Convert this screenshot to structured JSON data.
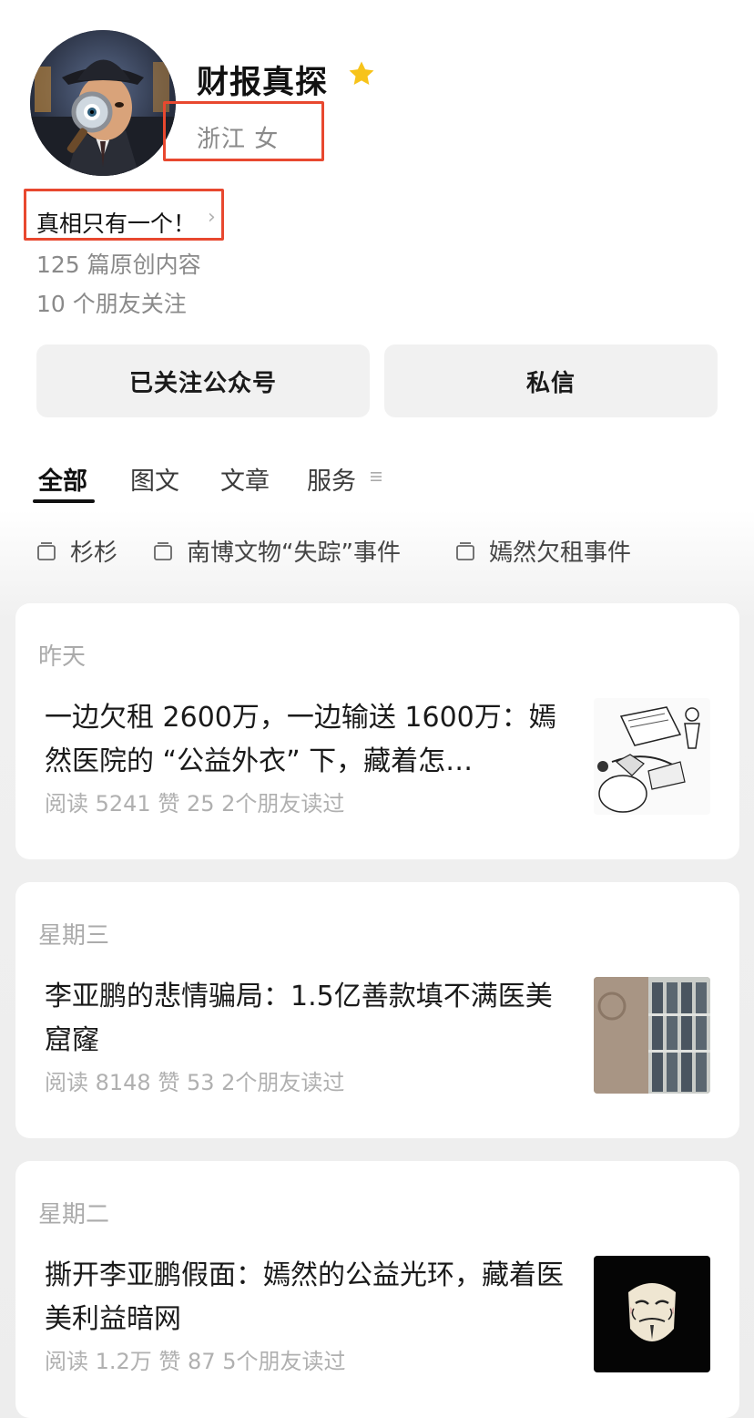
{
  "profile": {
    "name": "财报真探",
    "region": "浙江 女",
    "slogan": "真相只有一个！",
    "original_count": "125 篇原创内容",
    "friends_following": "10 个朋友关注",
    "star_icon": "star-icon",
    "accent_color": "#e8482f",
    "star_color": "#f7c31a"
  },
  "buttons": {
    "follow_label": "已关注公众号",
    "message_label": "私信"
  },
  "tabs": [
    {
      "label": "全部",
      "active": true
    },
    {
      "label": "图文",
      "active": false
    },
    {
      "label": "文章",
      "active": false
    },
    {
      "label": "服务",
      "active": false
    }
  ],
  "collections": [
    {
      "label": "杉杉"
    },
    {
      "label": "南博文物“失踪”事件"
    },
    {
      "label": "嫣然欠租事件"
    }
  ],
  "articles": [
    {
      "date": "昨天",
      "title": "一边欠租 2600万，一边输送 1600万：嫣然医院的 “公益外衣” 下，藏着怎…",
      "meta": "阅读 5241  赞 25  2个朋友读过"
    },
    {
      "date": "星期三",
      "title": "李亚鹏的悲情骗局：1.5亿善款填不满医美窟窿",
      "meta": "阅读 8148  赞 53  2个朋友读过"
    },
    {
      "date": "星期二",
      "title": "撕开李亚鹏假面：嫣然的公益光环，藏着医美利益暗网",
      "meta": "阅读 1.2万  赞 87  5个朋友读过"
    }
  ]
}
